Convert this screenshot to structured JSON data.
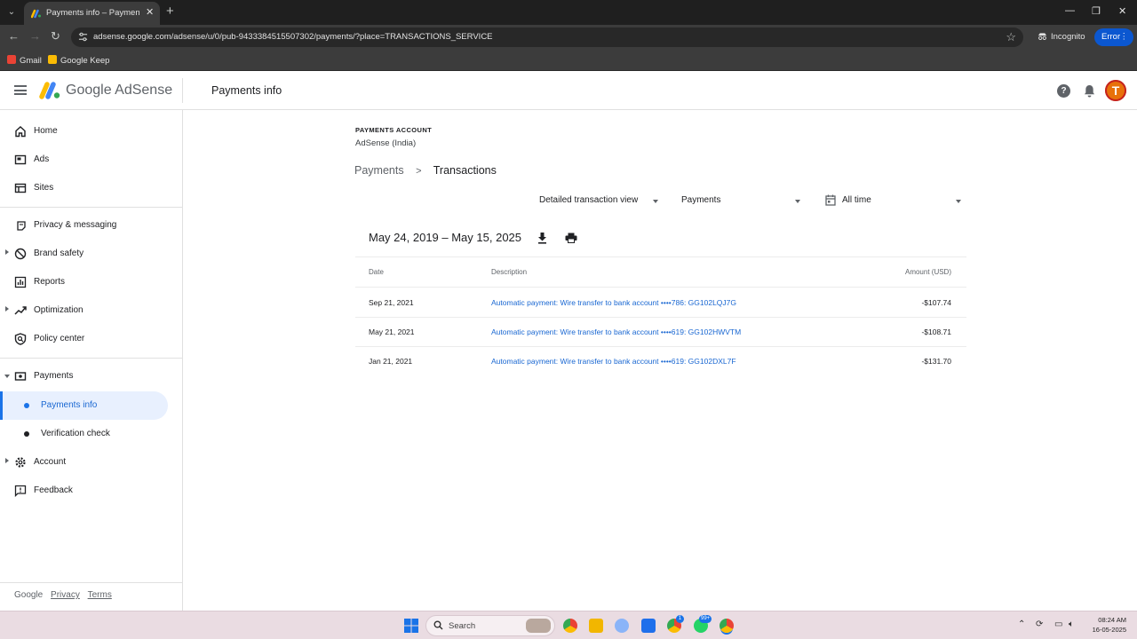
{
  "browser": {
    "tab_title": "Payments info – Payments – Go",
    "url": "adsense.google.com/adsense/u/0/pub-9433384515507302/payments/?place=TRANSACTIONS_SERVICE",
    "incognito_label": "Incognito",
    "error_label": "Error",
    "bookmarks": [
      {
        "label": "Gmail",
        "icon": "gmail-icon",
        "color": "#ea4335"
      },
      {
        "label": "Google Keep",
        "icon": "keep-icon",
        "color": "#fbbc04"
      }
    ]
  },
  "header": {
    "logo_text": "Google AdSense",
    "page_title": "Payments info",
    "avatar_letter": "T"
  },
  "sidebar": {
    "items": [
      {
        "label": "Home",
        "icon": "home-icon"
      },
      {
        "label": "Ads",
        "icon": "ads-icon"
      },
      {
        "label": "Sites",
        "icon": "sites-icon"
      },
      {
        "label": "Privacy & messaging",
        "icon": "privacy-icon"
      },
      {
        "label": "Brand safety",
        "icon": "block-icon"
      },
      {
        "label": "Reports",
        "icon": "reports-icon"
      },
      {
        "label": "Optimization",
        "icon": "trending-icon"
      },
      {
        "label": "Policy center",
        "icon": "policy-icon"
      },
      {
        "label": "Payments",
        "icon": "payments-icon"
      },
      {
        "label": "Account",
        "icon": "gear-icon"
      },
      {
        "label": "Feedback",
        "icon": "feedback-icon"
      }
    ],
    "payments_sub": [
      {
        "label": "Payments info",
        "active": true
      },
      {
        "label": "Verification check",
        "active": false
      }
    ],
    "footer": {
      "brand": "Google",
      "privacy": "Privacy",
      "terms": "Terms"
    }
  },
  "main": {
    "account_label": "PAYMENTS ACCOUNT",
    "account_name": "AdSense (India)",
    "breadcrumb": {
      "parent": "Payments",
      "separator": ">",
      "current": "Transactions"
    },
    "filters": {
      "view": "Detailed transaction view",
      "type": "Payments",
      "period": "All time"
    },
    "range_title": "May 24, 2019 – May 15, 2025",
    "table": {
      "headers": {
        "date": "Date",
        "description": "Description",
        "amount": "Amount (USD)"
      },
      "rows": [
        {
          "date": "Sep 21, 2021",
          "description": "Automatic payment: Wire transfer to bank account ••••786: GG102LQJ7G",
          "amount": "-$107.74"
        },
        {
          "date": "May 21, 2021",
          "description": "Automatic payment: Wire transfer to bank account ••••619: GG102HWVTM",
          "amount": "-$108.71"
        },
        {
          "date": "Jan 21, 2021",
          "description": "Automatic payment: Wire transfer to bank account ••••619: GG102DXL7F",
          "amount": "-$131.70"
        }
      ]
    }
  },
  "taskbar": {
    "search_placeholder": "Search",
    "badge_chrome": "1",
    "badge_whatsapp": "99+",
    "time": "08:24 AM",
    "date": "16-05-2025"
  }
}
